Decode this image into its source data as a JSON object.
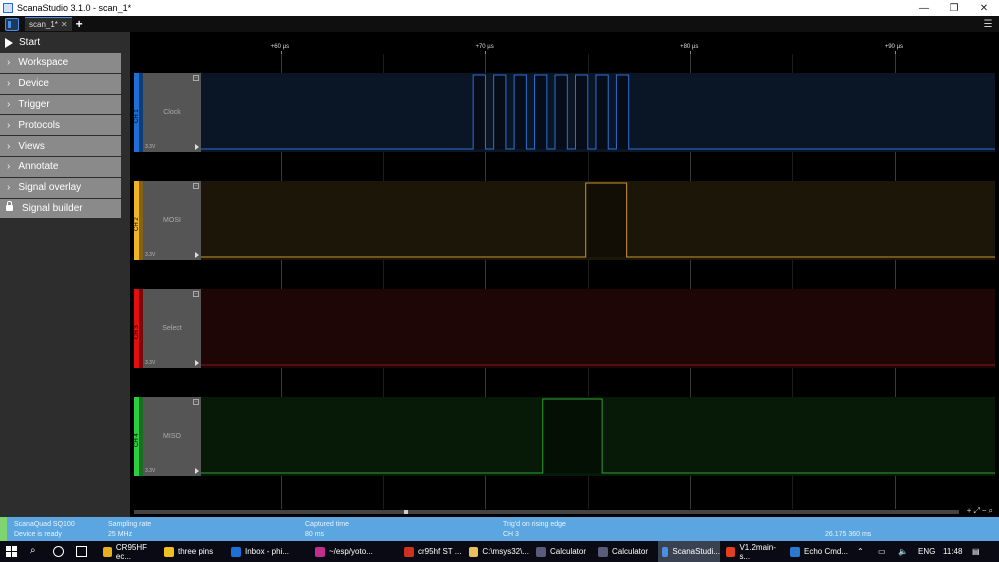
{
  "window": {
    "title": "ScanaStudio 3.1.0 - scan_1*",
    "controls": [
      "—",
      "❐",
      "✕"
    ]
  },
  "tabs": [
    {
      "label": "scan_1*",
      "close": "✕"
    }
  ],
  "tab_add": "+",
  "settings_icon": "sliders-icon",
  "sidebar": {
    "start_label": "Start",
    "items": [
      {
        "label": "Workspace",
        "icon": "chevron-right-icon"
      },
      {
        "label": "Device",
        "icon": "chevron-right-icon"
      },
      {
        "label": "Trigger",
        "icon": "chevron-right-icon"
      },
      {
        "label": "Protocols",
        "icon": "chevron-right-icon"
      },
      {
        "label": "Views",
        "icon": "chevron-right-icon"
      },
      {
        "label": "Annotate",
        "icon": "chevron-right-icon"
      },
      {
        "label": "Signal overlay",
        "icon": "chevron-right-icon"
      },
      {
        "label": "Signal builder",
        "icon": "lock-icon"
      }
    ]
  },
  "ruler": {
    "ticks": [
      "+60 µs",
      "+70 µs",
      "+80 µs",
      "+90 µs"
    ]
  },
  "channels": [
    {
      "id": "CH 1",
      "name": "Clock",
      "voltage": "3.3V",
      "color": "#1e6fd6",
      "bg": "#0a1526",
      "line": "#2e6fd0",
      "edges_us": [
        69.4,
        70.0,
        70.4,
        71.0,
        71.4,
        72.0,
        72.4,
        73.0,
        73.4,
        74.0,
        74.4,
        75.0,
        75.4,
        76.0,
        76.4,
        77.0
      ],
      "initial": 0
    },
    {
      "id": "CH 2",
      "name": "MOSI",
      "voltage": "3.3V",
      "color": "#f0b429",
      "bg": "#1c1608",
      "line": "#c8952a",
      "edges_us": [
        74.9,
        76.9
      ],
      "initial": 0
    },
    {
      "id": "CH 3",
      "name": "Select",
      "voltage": "3.3V",
      "color": "#e01010",
      "bg": "#1f0606",
      "line": "#8a1a1a",
      "edges_us": [],
      "initial": 0
    },
    {
      "id": "CH 4",
      "name": "MISO",
      "voltage": "3.3V",
      "color": "#2ecc40",
      "bg": "#071a07",
      "line": "#2ea030",
      "edges_us": [
        72.8,
        75.7
      ],
      "initial": 0
    }
  ],
  "time_axis": {
    "start_us": 56.1,
    "end_us": 94.9
  },
  "status": {
    "device_name": "ScanaQuad SQ100",
    "device_state": "Device is ready",
    "sampling_label": "Sampling rate",
    "sampling_value": "25 MHz",
    "captured_label": "Captured time",
    "captured_value": "80 ms",
    "trigger_label": "Trig'd on rising edge",
    "trigger_value": "CH 3",
    "cursor_value": "26.175 360 ms"
  },
  "taskbar": {
    "apps": [
      {
        "label": "CR95HF ec...",
        "color": "#e8b020"
      },
      {
        "label": "three pins",
        "color": "#f0c020"
      },
      {
        "label": "Inbox - phi...",
        "color": "#1e6fd6"
      },
      {
        "label": "~/esp/yoto...",
        "color": "#c0308a"
      },
      {
        "label": "cr95hf ST ...",
        "color": "#d03020"
      },
      {
        "label": "C:\\msys32\\...",
        "color": "#e8c060"
      },
      {
        "label": "Calculator",
        "color": "#5a5a7a"
      },
      {
        "label": "Calculator",
        "color": "#5a5a7a"
      },
      {
        "label": "ScanaStudi...",
        "color": "#4a90e2"
      },
      {
        "label": "V1.2main-s...",
        "color": "#e04020"
      },
      {
        "label": "Echo Cmd...",
        "color": "#2a7ad0"
      }
    ],
    "lang": "ENG",
    "time": "11:48"
  }
}
